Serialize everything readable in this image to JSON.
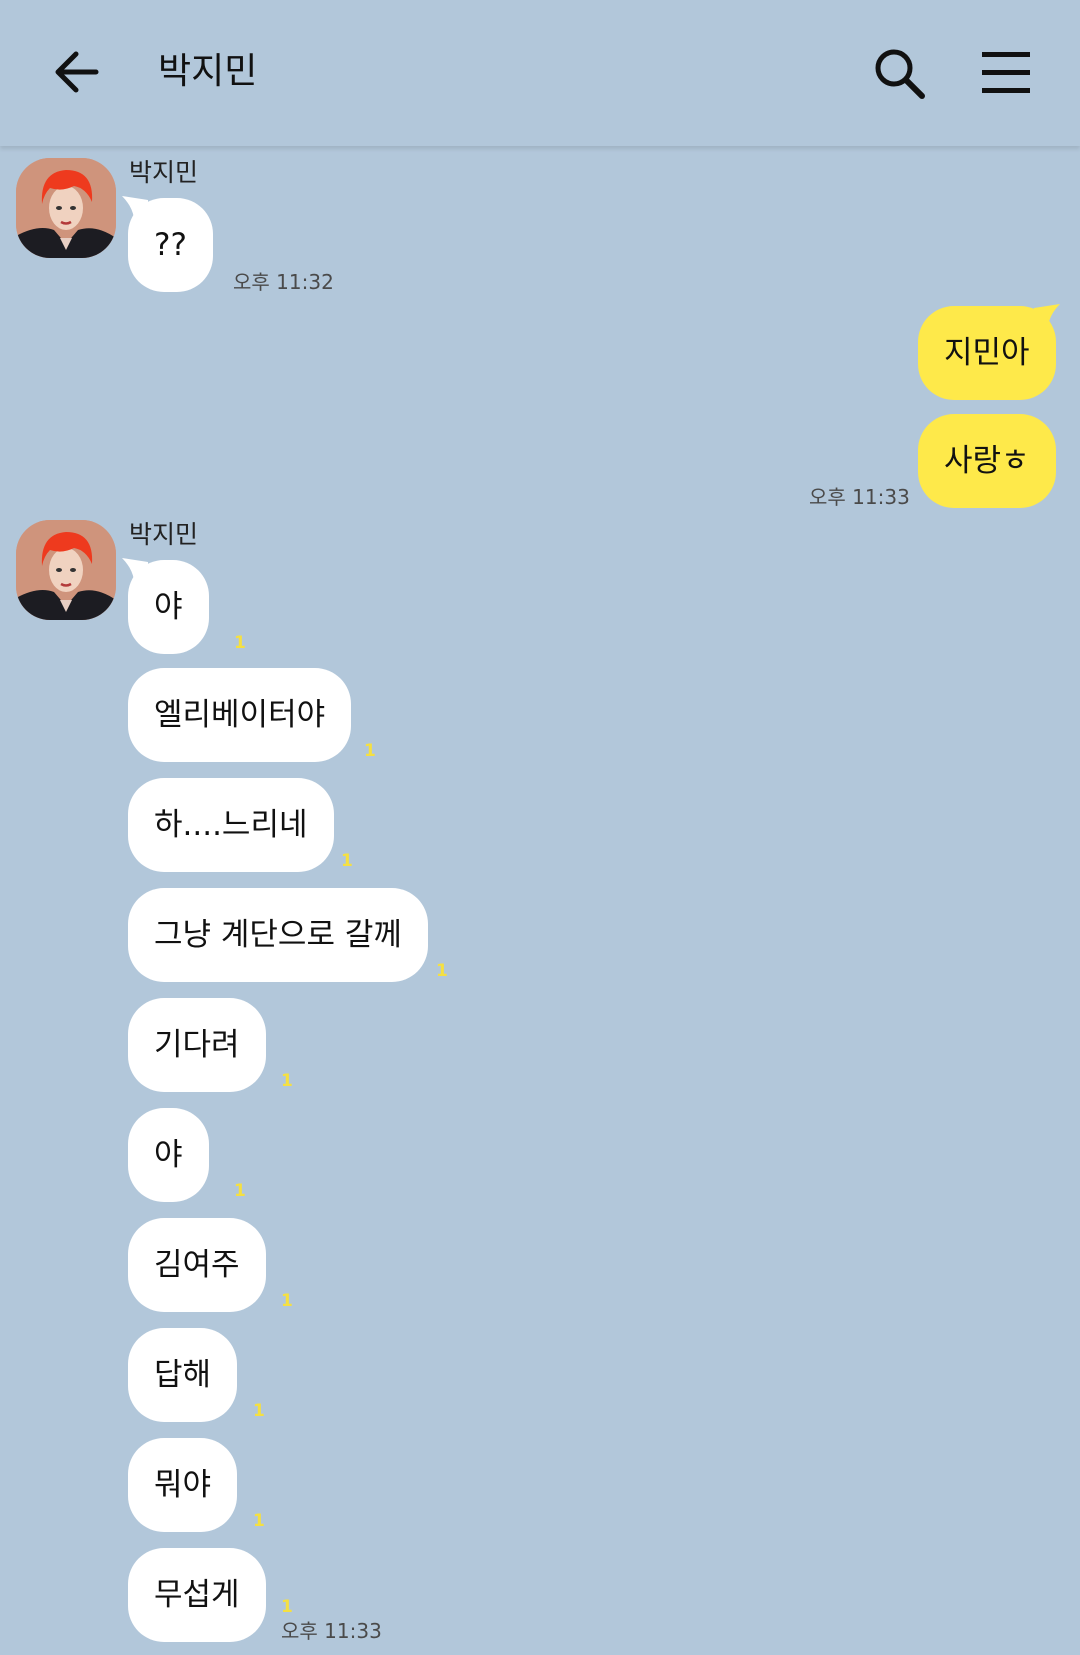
{
  "header": {
    "title": "박지민",
    "back_icon": "arrow-left-icon",
    "search_icon": "search-icon",
    "menu_icon": "hamburger-menu-icon"
  },
  "colors": {
    "background": "#b2c7da",
    "incoming_bubble": "#ffffff",
    "outgoing_bubble": "#fee94a",
    "unread_count": "#f5e041"
  },
  "messages": {
    "group1": {
      "sender": "박지민",
      "m1": {
        "text": "??"
      },
      "time": "오후 11:32"
    },
    "group2": {
      "m1": {
        "text": "지민아"
      },
      "m2": {
        "text": "사랑ㅎ"
      },
      "time": "오후 11:33"
    },
    "group3": {
      "sender": "박지민",
      "m1": {
        "text": "야",
        "unread": "1"
      },
      "m2": {
        "text": "엘리베이터야",
        "unread": "1"
      },
      "m3": {
        "text": "하....느리네",
        "unread": "1"
      },
      "m4": {
        "text": "그냥 계단으로 갈께",
        "unread": "1"
      },
      "m5": {
        "text": "기다려",
        "unread": "1"
      },
      "m6": {
        "text": "야",
        "unread": "1"
      },
      "m7": {
        "text": "김여주",
        "unread": "1"
      },
      "m8": {
        "text": "답해",
        "unread": "1"
      },
      "m9": {
        "text": "뭐야",
        "unread": "1"
      },
      "m10": {
        "text": "무섭게",
        "unread": "1"
      },
      "time": "오후 11:33"
    }
  }
}
